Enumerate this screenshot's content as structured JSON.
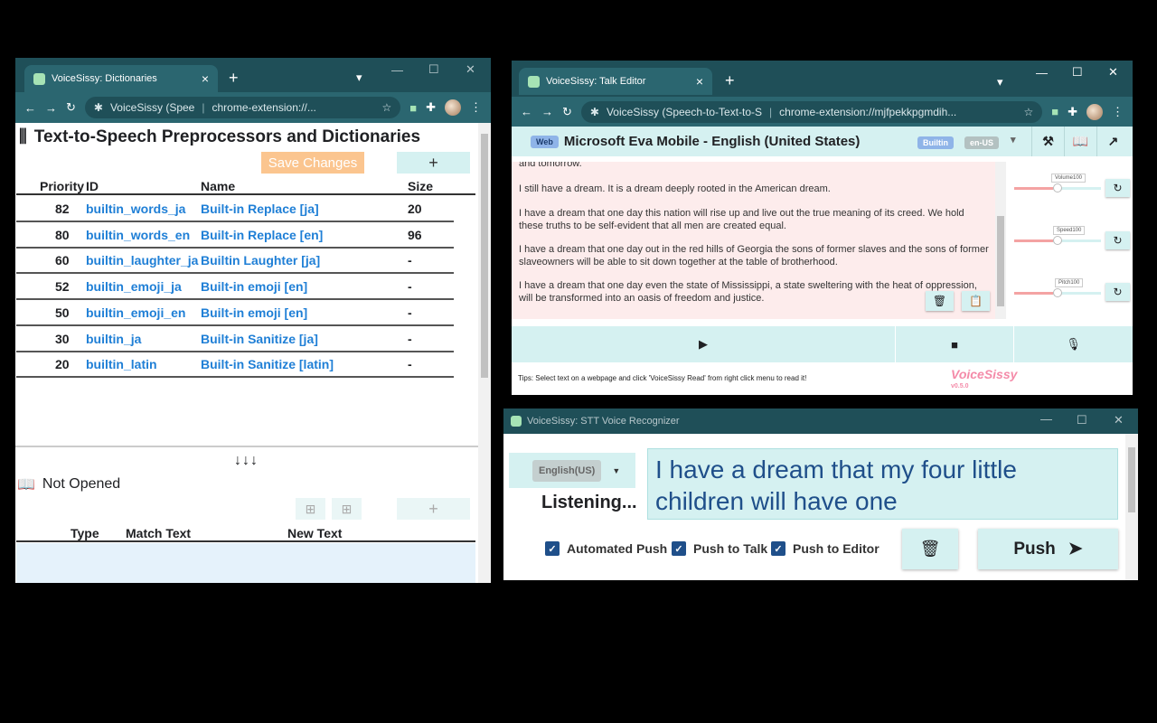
{
  "dict_window": {
    "tab_title": "VoiceSissy: Dictionaries",
    "omnibox_site": "VoiceSissy (Spee",
    "omnibox_url": "chrome-extension://...",
    "heading": "Text-to-Speech Preprocessors and Dictionaries",
    "save_label": "Save Changes",
    "add_label": "+",
    "columns": {
      "priority": "Priority",
      "id": "ID",
      "name": "Name",
      "size": "Size"
    },
    "rows": [
      {
        "priority": "82",
        "id": "builtin_words_ja",
        "name": "Built-in Replace [ja]",
        "size": "20"
      },
      {
        "priority": "80",
        "id": "builtin_words_en",
        "name": "Built-in Replace [en]",
        "size": "96"
      },
      {
        "priority": "60",
        "id": "builtin_laughter_ja",
        "name": "Builtin Laughter [ja]",
        "size": "-"
      },
      {
        "priority": "52",
        "id": "builtin_emoji_ja",
        "name": "Built-in emoji [en]",
        "size": "-"
      },
      {
        "priority": "50",
        "id": "builtin_emoji_en",
        "name": "Built-in emoji [en]",
        "size": "-"
      },
      {
        "priority": "30",
        "id": "builtin_ja",
        "name": "Built-in Sanitize [ja]",
        "size": "-"
      },
      {
        "priority": "20",
        "id": "builtin_latin",
        "name": "Built-in Sanitize [latin]",
        "size": "-"
      }
    ],
    "arrows": "↓↓↓",
    "not_opened": "Not Opened",
    "add2_label": "+",
    "columns2": {
      "type": "Type",
      "match": "Match Text",
      "new": "New Text"
    }
  },
  "editor_window": {
    "tab_title": "VoiceSissy: Talk Editor",
    "omnibox_site": "VoiceSissy (Speech-to-Text-to-S",
    "omnibox_url": "chrome-extension://mjfpekkpgmdih...",
    "web_badge": "Web",
    "voice_name": "Microsoft Eva Mobile - English (United States)",
    "builtin_badge": "Builtin",
    "lang_badge": "en-US",
    "paragraphs": [
      "and tomorrow.",
      "I still have a dream. It is a dream deeply rooted in the American dream.",
      "I have a dream that one day this nation will rise up and live out the true meaning of its creed. We hold these truths to be self-evident that all men are created equal.",
      "I have a dream that one day out in the red hills of Georgia the sons of former slaves and the sons of former slaveowners will be able to sit down together at the table of brotherhood.",
      "I have a dream that one day even the state of Mississippi, a state sweltering with the heat of oppression, will be transformed into an oasis of freedom and justice."
    ],
    "volume_label": "Volume100",
    "speed_label": "Speed100",
    "pitch_label": "Pitch100",
    "tips": "Tips: Select text on a webpage and click 'VoiceSissy Read' from right click menu to read it!",
    "logo": "VoiceSissy",
    "version": "v0.5.0"
  },
  "stt_window": {
    "title": "VoiceSissy: STT Voice Recognizer",
    "language": "English(US)",
    "status": "Listening...",
    "transcript": "I have a dream that my four little children will have one",
    "checkboxes": [
      "Automated Push",
      "Push to Talk",
      "Push to Editor"
    ],
    "push_label": "Push"
  },
  "colors": {
    "chrome": "#1f4f58",
    "accent": "#d5f1f1",
    "link": "#1f7fd6",
    "editor_bg": "#fdecec"
  }
}
